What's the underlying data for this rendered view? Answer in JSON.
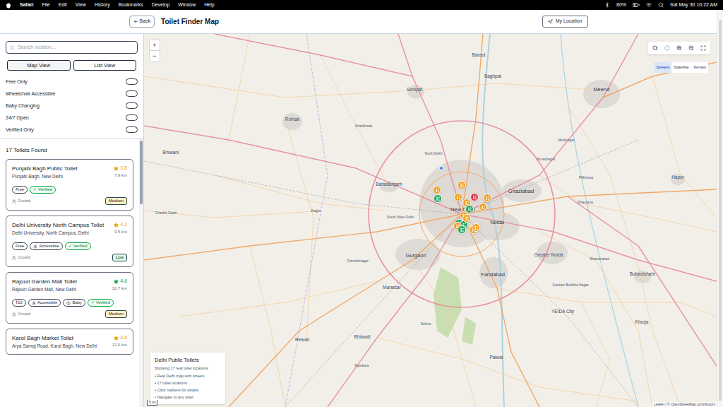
{
  "menubar": {
    "app": "Safari",
    "menus": [
      "File",
      "Edit",
      "View",
      "History",
      "Bookmarks",
      "Develop",
      "Window",
      "Help"
    ],
    "battery": "80%",
    "clock": "Sat May 30 10:22 AM"
  },
  "header": {
    "back": "Back",
    "title": "Toilet Finder Map",
    "location_button": "My Location"
  },
  "sidebar": {
    "search": {
      "placeholder": "Search location..."
    },
    "views": [
      {
        "label": "Map View",
        "selected": true
      },
      {
        "label": "List View",
        "selected": false
      }
    ],
    "filters": [
      {
        "label": "Free Only",
        "on": false
      },
      {
        "label": "Wheelchair Accessible",
        "on": false
      },
      {
        "label": "Baby Changing",
        "on": false
      },
      {
        "label": "24/7 Open",
        "on": false
      },
      {
        "label": "Verified Only",
        "on": false
      }
    ],
    "count": "17 Toilets Found",
    "cards": [
      {
        "name": "Punjabi Bagh Public Toilet",
        "rating": "3.8",
        "rating_color": "#e8a317",
        "distance": "7.9 km",
        "location": "Punjabi Bagh, New Delhi",
        "tags": [
          {
            "label": "Free",
            "kind": "plain"
          },
          {
            "label": "✓ Verified",
            "kind": "verified"
          }
        ],
        "crowd_label": "Crowd:",
        "crowd": {
          "label": "Medium",
          "color": "#fef3c7"
        }
      },
      {
        "name": "Delhi University North Campus Toilet",
        "rating": "4.2",
        "rating_color": "#e8a317",
        "distance": "9.5 km",
        "location": "Delhi University, North Campus, Delhi",
        "tags": [
          {
            "label": "Free",
            "kind": "plain"
          },
          {
            "label": "Accessible",
            "kind": "accessible"
          },
          {
            "label": "✓ Verified",
            "kind": "verified"
          }
        ],
        "crowd_label": "Crowd:",
        "crowd": {
          "label": "Low",
          "color": "#dcfce7"
        }
      },
      {
        "name": "Rajouri Garden Mall Toilet",
        "rating": "4.6",
        "rating_color": "#16a34a",
        "distance": "10.7 km",
        "location": "Rajouri Garden Mall, New Delhi",
        "tags": [
          {
            "label": "₹10",
            "kind": "plain"
          },
          {
            "label": "Accessible",
            "kind": "accessible"
          },
          {
            "label": "Baby",
            "kind": "baby"
          },
          {
            "label": "✓ Verified",
            "kind": "verified"
          }
        ],
        "crowd_label": "Crowd:",
        "crowd": {
          "label": "Medium",
          "color": "#fef3c7"
        }
      },
      {
        "name": "Karol Bagh Market Toilet",
        "rating": "3.8",
        "rating_color": "#e8a317",
        "distance": "12.0 km",
        "location": "Arya Samaj Road, Karol Bagh, New Delhi",
        "tags": [],
        "crowd_label": "",
        "crowd": {
          "label": "",
          "color": "#ffffff"
        }
      }
    ]
  },
  "map": {
    "zoom_in": "+",
    "zoom_out": "−",
    "layers": [
      {
        "label": "Streets",
        "selected": true
      },
      {
        "label": "Satellite",
        "selected": false
      },
      {
        "label": "Terrain",
        "selected": false
      }
    ],
    "places": [
      {
        "name": "Baraut",
        "kind": "town"
      },
      {
        "name": "Baghpat",
        "kind": "town"
      },
      {
        "name": "Sonipat",
        "kind": "town"
      },
      {
        "name": "Meerut",
        "kind": "city"
      },
      {
        "name": "Rohtak",
        "kind": "town"
      },
      {
        "name": "Kharkhoda",
        "kind": "village"
      },
      {
        "name": "Bahadurgarh",
        "kind": "town"
      },
      {
        "name": "North Delhi",
        "kind": "village"
      },
      {
        "name": "New Delhi",
        "kind": "city"
      },
      {
        "name": "Ghaziabad",
        "kind": "city"
      },
      {
        "name": "Noida",
        "kind": "city"
      },
      {
        "name": "Muradnagar",
        "kind": "village"
      },
      {
        "name": "Modinagar",
        "kind": "village"
      },
      {
        "name": "Hapur",
        "kind": "town"
      },
      {
        "name": "Pilkhuwa",
        "kind": "village"
      },
      {
        "name": "Dhaulana",
        "kind": "village"
      },
      {
        "name": "South West Delhi",
        "kind": "village"
      },
      {
        "name": "Gurgaon",
        "kind": "city"
      },
      {
        "name": "Greater Noida",
        "kind": "town"
      },
      {
        "name": "Faridabad",
        "kind": "city"
      },
      {
        "name": "Manesar",
        "kind": "town"
      },
      {
        "name": "Bulandshahr",
        "kind": "town"
      },
      {
        "name": "Jhajjar",
        "kind": "village"
      },
      {
        "name": "Bhiwani",
        "kind": "town"
      },
      {
        "name": "Charkhi Dadri",
        "kind": "village"
      },
      {
        "name": "Rewari",
        "kind": "town"
      },
      {
        "name": "Bhiwadi",
        "kind": "town"
      },
      {
        "name": "Palwal",
        "kind": "town"
      },
      {
        "name": "YEIDA City",
        "kind": "town"
      },
      {
        "name": "Gautam Buddha Nagar",
        "kind": "village"
      },
      {
        "name": "Khurja",
        "kind": "town"
      },
      {
        "name": "Tapukara",
        "kind": "village"
      },
      {
        "name": "Farrukhnagar",
        "kind": "village"
      },
      {
        "name": "Sohna",
        "kind": "village"
      },
      {
        "name": "Sikandrabad",
        "kind": "village"
      }
    ],
    "markers": [
      {
        "color": "#f0a020"
      },
      {
        "color": "#f0a020"
      },
      {
        "color": "#22a35a"
      },
      {
        "color": "#f0a020"
      },
      {
        "color": "#f0a020"
      },
      {
        "color": "#dc3545"
      },
      {
        "color": "#f0a020"
      },
      {
        "color": "#f0a020"
      },
      {
        "color": "#22a35a"
      },
      {
        "color": "#f0a020"
      },
      {
        "color": "#22a35a"
      },
      {
        "color": "#22a35a"
      },
      {
        "color": "#f0a020"
      },
      {
        "color": "#f0a020"
      },
      {
        "color": "#f0a020"
      },
      {
        "color": "#f0a020"
      },
      {
        "color": "#22a35a"
      }
    ],
    "info": {
      "title": "Delhi Public Toilets",
      "subtitle": "Showing 17 real toilet locations",
      "bullets": [
        "• Real Delhi map with streets",
        "• 17 toilet locations",
        "• Click markers for details",
        "• Navigate to any toilet"
      ]
    },
    "scale": "5 mi",
    "attribution": "Leaflet | © OpenStreetMap contributors"
  }
}
